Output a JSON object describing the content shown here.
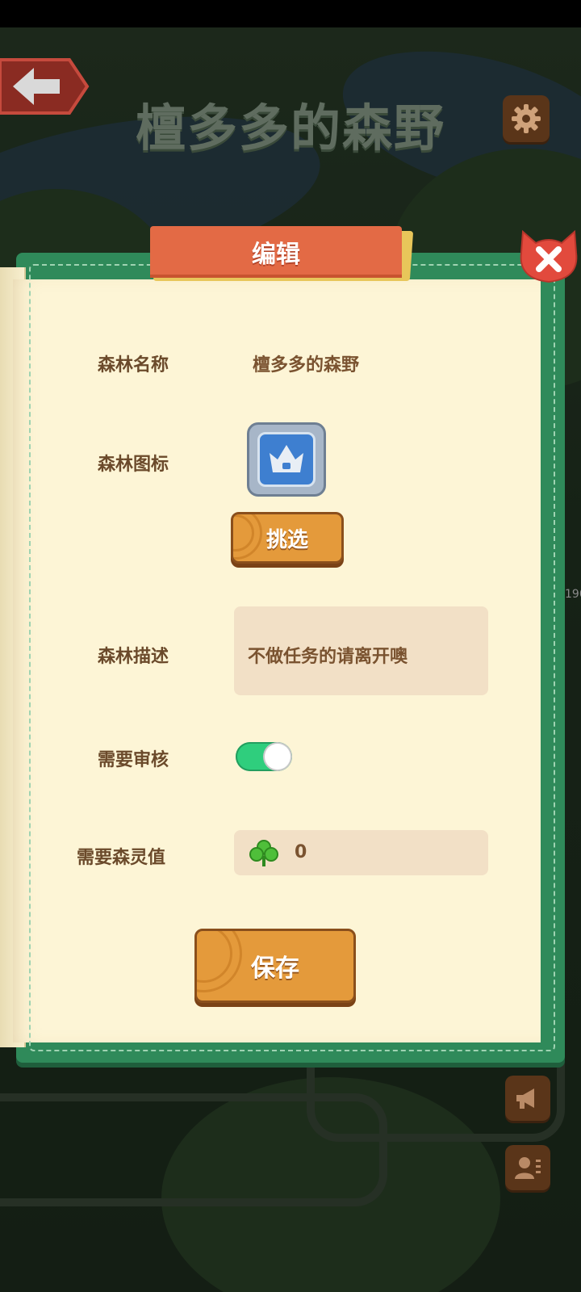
{
  "header": {
    "title": "檀多多的森野"
  },
  "dialog": {
    "tab_title": "编辑",
    "fields": {
      "name_label": "森林名称",
      "name_value": "檀多多的森野",
      "icon_label": "森林图标",
      "pick_button": "挑选",
      "desc_label": "森林描述",
      "desc_value": "不做任务的请离开噢",
      "review_label": "需要审核",
      "review_enabled": true,
      "spirit_label": "需要森灵值",
      "spirit_value": "0"
    },
    "save_button": "保存"
  },
  "background": {
    "edge_text": "190"
  },
  "colors": {
    "panel_green": "#2f8a5a",
    "tab_orange": "#e36a45",
    "wood_orange": "#e49a3b",
    "toggle_on": "#2fce7d",
    "paper": "#fdf5d6",
    "label_brown": "#6b4a2b"
  },
  "icons": [
    "back-arrow-icon",
    "gear-icon",
    "close-icon",
    "crown-icon",
    "clover-icon",
    "megaphone-icon",
    "contacts-icon"
  ]
}
